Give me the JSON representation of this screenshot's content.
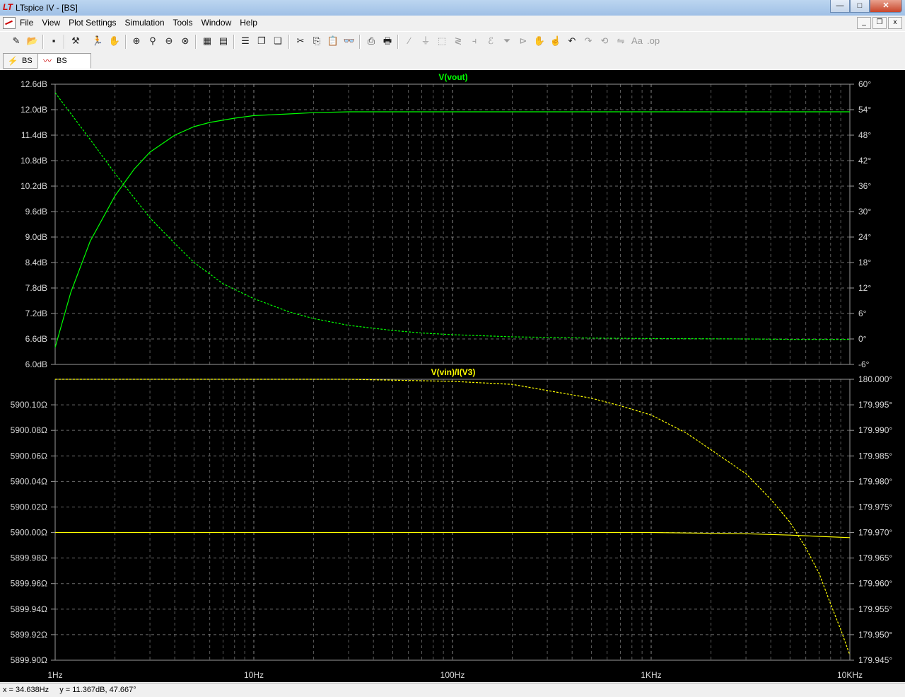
{
  "window": {
    "title": "LTspice IV - [BS]",
    "logo": "LT"
  },
  "window_buttons": {
    "minimize": "—",
    "maximize": "□",
    "close": "✕"
  },
  "menu": [
    "File",
    "View",
    "Plot Settings",
    "Simulation",
    "Tools",
    "Window",
    "Help"
  ],
  "mdi_buttons": {
    "minimize": "_",
    "restore": "❐",
    "close": "x"
  },
  "toolbar_icons": [
    "new-schematic-icon",
    "open-icon",
    "save-icon",
    "control-panel-icon",
    "run-icon",
    "halt-icon",
    "zoom-in-icon",
    "zoom-pan-icon",
    "zoom-out-icon",
    "zoom-cancel-icon",
    "autorange-icon",
    "visible-traces-icon",
    "tile-horizontal-icon",
    "tile-vertical-icon",
    "cascade-icon",
    "cut-icon",
    "copy-icon",
    "paste-icon",
    "find-icon",
    "print-setup-icon",
    "print-icon",
    "wire-icon",
    "ground-icon",
    "label-icon",
    "resistor-icon",
    "capacitor-icon",
    "inductor-icon",
    "diode-icon",
    "component-icon",
    "move-icon",
    "drag-icon",
    "undo-icon",
    "redo-icon",
    "rotate-icon",
    "mirror-icon",
    "text-icon",
    "spice-directive-icon"
  ],
  "tabs": [
    {
      "label": "BS",
      "icon": "schematic-icon"
    },
    {
      "label": "BS",
      "icon": "waveform-icon"
    }
  ],
  "status": {
    "x": "x = 34.638Hz",
    "y": "y = 11.367dB, 47.667°"
  },
  "colors": {
    "pane1": "#00ff00",
    "pane2": "#ffff00",
    "grid": "#9a9a9a",
    "background": "#000000"
  },
  "chart_data": [
    {
      "type": "line",
      "title": "V(vout)",
      "x_scale": "log",
      "xlim": [
        1,
        10000
      ],
      "x_ticks": [
        "1Hz",
        "10Hz",
        "100Hz",
        "1KHz",
        "10KHz"
      ],
      "y_left_ticks": [
        "12.6dB",
        "12.0dB",
        "11.4dB",
        "10.8dB",
        "10.2dB",
        "9.6dB",
        "9.0dB",
        "8.4dB",
        "7.8dB",
        "7.2dB",
        "6.6dB",
        "6.0dB"
      ],
      "y_right_ticks": [
        "60°",
        "54°",
        "48°",
        "42°",
        "36°",
        "30°",
        "24°",
        "18°",
        "12°",
        "6°",
        "0°",
        "-6°"
      ],
      "ylim_left": [
        6.0,
        12.6
      ],
      "ylim_right": [
        -6,
        60
      ],
      "series": [
        {
          "name": "magnitude",
          "axis": "left",
          "style": "solid",
          "x": [
            1,
            1.2,
            1.5,
            2,
            2.5,
            3,
            4,
            5,
            6,
            8,
            10,
            15,
            20,
            30,
            50,
            100,
            1000,
            10000
          ],
          "y": [
            6.4,
            7.7,
            8.9,
            9.97,
            10.6,
            11.0,
            11.4,
            11.6,
            11.7,
            11.8,
            11.86,
            11.9,
            11.93,
            11.95,
            11.95,
            11.95,
            11.95,
            11.95
          ]
        },
        {
          "name": "phase",
          "axis": "right",
          "style": "dashed",
          "x": [
            1,
            1.5,
            2,
            3,
            4,
            5,
            7,
            10,
            15,
            20,
            30,
            50,
            70,
            100,
            200,
            500,
            1000,
            3000,
            5000,
            10000
          ],
          "y": [
            58,
            47,
            39,
            28.5,
            22.5,
            18,
            13,
            9.5,
            6.4,
            4.8,
            3.2,
            2,
            1.4,
            1,
            0.5,
            0.2,
            0.1,
            0,
            -0.1,
            -0.1
          ]
        }
      ]
    },
    {
      "type": "line",
      "title": "V(vin)/I(V3)",
      "x_scale": "log",
      "xlim": [
        1,
        10000
      ],
      "x_ticks": [
        "1Hz",
        "10Hz",
        "100Hz",
        "1KHz",
        "10KHz"
      ],
      "y_left_ticks": [
        "5900.10Ω",
        "5900.08Ω",
        "5900.06Ω",
        "5900.04Ω",
        "5900.02Ω",
        "5900.00Ω",
        "5899.98Ω",
        "5899.96Ω",
        "5899.94Ω",
        "5899.92Ω",
        "5899.90Ω"
      ],
      "y_right_ticks": [
        "180.000°",
        "179.995°",
        "179.990°",
        "179.985°",
        "179.980°",
        "179.975°",
        "179.970°",
        "179.965°",
        "179.960°",
        "179.955°",
        "179.950°",
        "179.945°"
      ],
      "ylim_left": [
        5899.9,
        5900.12
      ],
      "ylim_right": [
        179.945,
        180.0
      ],
      "series": [
        {
          "name": "magnitude",
          "axis": "left",
          "style": "solid",
          "x": [
            1,
            100,
            1000,
            3000,
            5000,
            7000,
            10000
          ],
          "y": [
            5900.0,
            5900.0,
            5900.0,
            5899.999,
            5899.998,
            5899.997,
            5899.996
          ]
        },
        {
          "name": "phase",
          "axis": "right",
          "style": "dashed",
          "x": [
            1,
            10,
            30,
            100,
            200,
            300,
            500,
            700,
            1000,
            1500,
            2000,
            3000,
            4000,
            5000,
            6000,
            7000,
            8000,
            9000,
            10000
          ],
          "y": [
            180.0,
            180.0,
            180.0,
            179.9996,
            179.999,
            179.9978,
            179.9963,
            179.9948,
            179.993,
            179.9895,
            179.9862,
            179.9815,
            179.9765,
            179.972,
            179.967,
            179.962,
            179.956,
            179.951,
            179.946
          ]
        }
      ]
    }
  ]
}
